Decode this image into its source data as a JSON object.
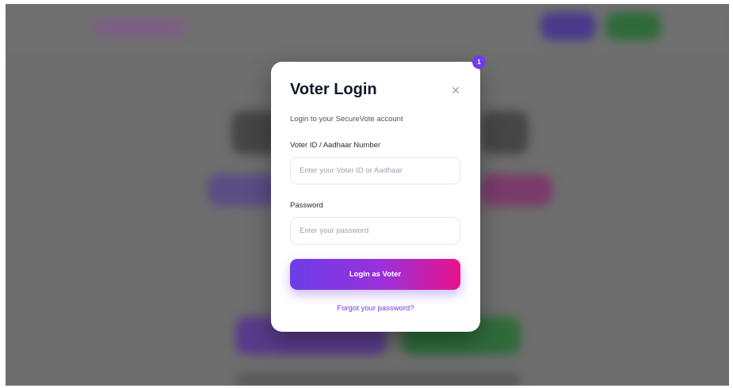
{
  "modal": {
    "title": "Voter Login",
    "subtitle": "Login to your SecureVote account",
    "close_icon": "close-icon",
    "badge": "1"
  },
  "form": {
    "voter_id_label": "Voter ID / Aadhaar Number",
    "voter_id_placeholder": "Enter your Voter ID or Aadhaar",
    "voter_id_value": "",
    "password_label": "Password",
    "password_placeholder": "Enter your password",
    "password_value": ""
  },
  "actions": {
    "login_label": "Login as Voter",
    "forgot_label": "Forgot your password?"
  },
  "colors": {
    "accent": "#6d3de8",
    "gradient_end": "#e8138a",
    "overlay": "#6e6e6e"
  }
}
